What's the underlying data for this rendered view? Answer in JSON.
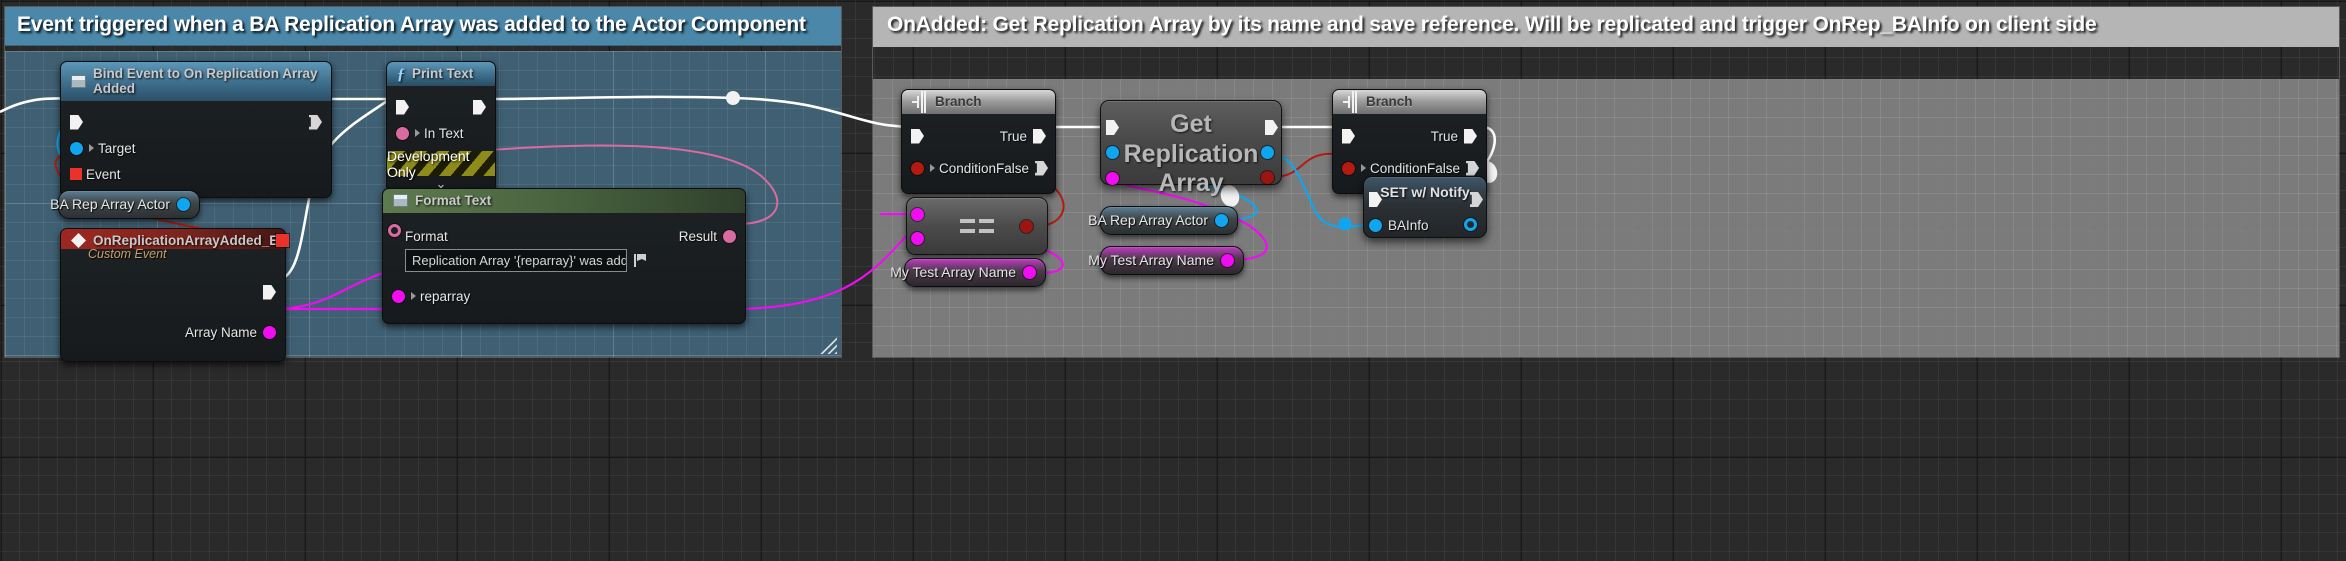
{
  "comments": {
    "left": {
      "title": "Event triggered when a BA Replication Array was added to the Actor Component",
      "color": "#4a87a9"
    },
    "right": {
      "title": "OnAdded: Get Replication Array by its name and save reference. Will be replicated and trigger OnRep_BAInfo on client side",
      "color": "#b5b5b5"
    }
  },
  "nodes": {
    "bind_event": {
      "title": "Bind Event to On Replication Array Added",
      "icon": "window-icon",
      "pins": {
        "target": "Target",
        "event": "Event"
      }
    },
    "print_text": {
      "title": "Print Text",
      "icon": "function-icon",
      "pins": {
        "in_text": "In Text"
      },
      "dev_bar": "Development Only",
      "expander": "⌄"
    },
    "ba_rep_array_actor_left": {
      "label": "BA Rep Array Actor"
    },
    "custom_event": {
      "title": "OnReplicationArrayAdded_Event",
      "subtitle": "Custom Event",
      "icon": "diamond-icon",
      "pins": {
        "array_name": "Array Name"
      }
    },
    "format_text": {
      "title": "Format Text",
      "icon": "window-icon",
      "pins": {
        "format": "Format",
        "result": "Result",
        "reparray": "reparray"
      },
      "format_value": "Replication Array '{reparray}' was added"
    },
    "branch_left": {
      "title": "Branch",
      "icon": "branch-icon",
      "pins": {
        "condition": "Condition",
        "true": "True",
        "false": "False"
      }
    },
    "equality": {
      "glyph": "=="
    },
    "my_test_array_name_left": {
      "label": "My Test Array Name"
    },
    "get_replication_array": {
      "title": "Get\nReplication\nArray"
    },
    "ba_rep_array_actor_right": {
      "label": "BA Rep Array Actor"
    },
    "my_test_array_name_right": {
      "label": "My Test Array Name"
    },
    "branch_right": {
      "title": "Branch",
      "icon": "branch-icon",
      "pins": {
        "condition": "Condition",
        "true": "True",
        "false": "False"
      }
    },
    "set_notify": {
      "title": "SET w/ Notify",
      "pins": {
        "bainfo": "BAInfo"
      }
    }
  },
  "colors": {
    "exec_wire": "#ffffff",
    "object_wire": "#0fa6ef",
    "bool_wire": "#b31b12",
    "name_wire": "#f10df1",
    "text_wire": "#d96ba0",
    "graph_bg_blue": "#3f5f72",
    "graph_bg_gray": "#7b7b7b"
  }
}
